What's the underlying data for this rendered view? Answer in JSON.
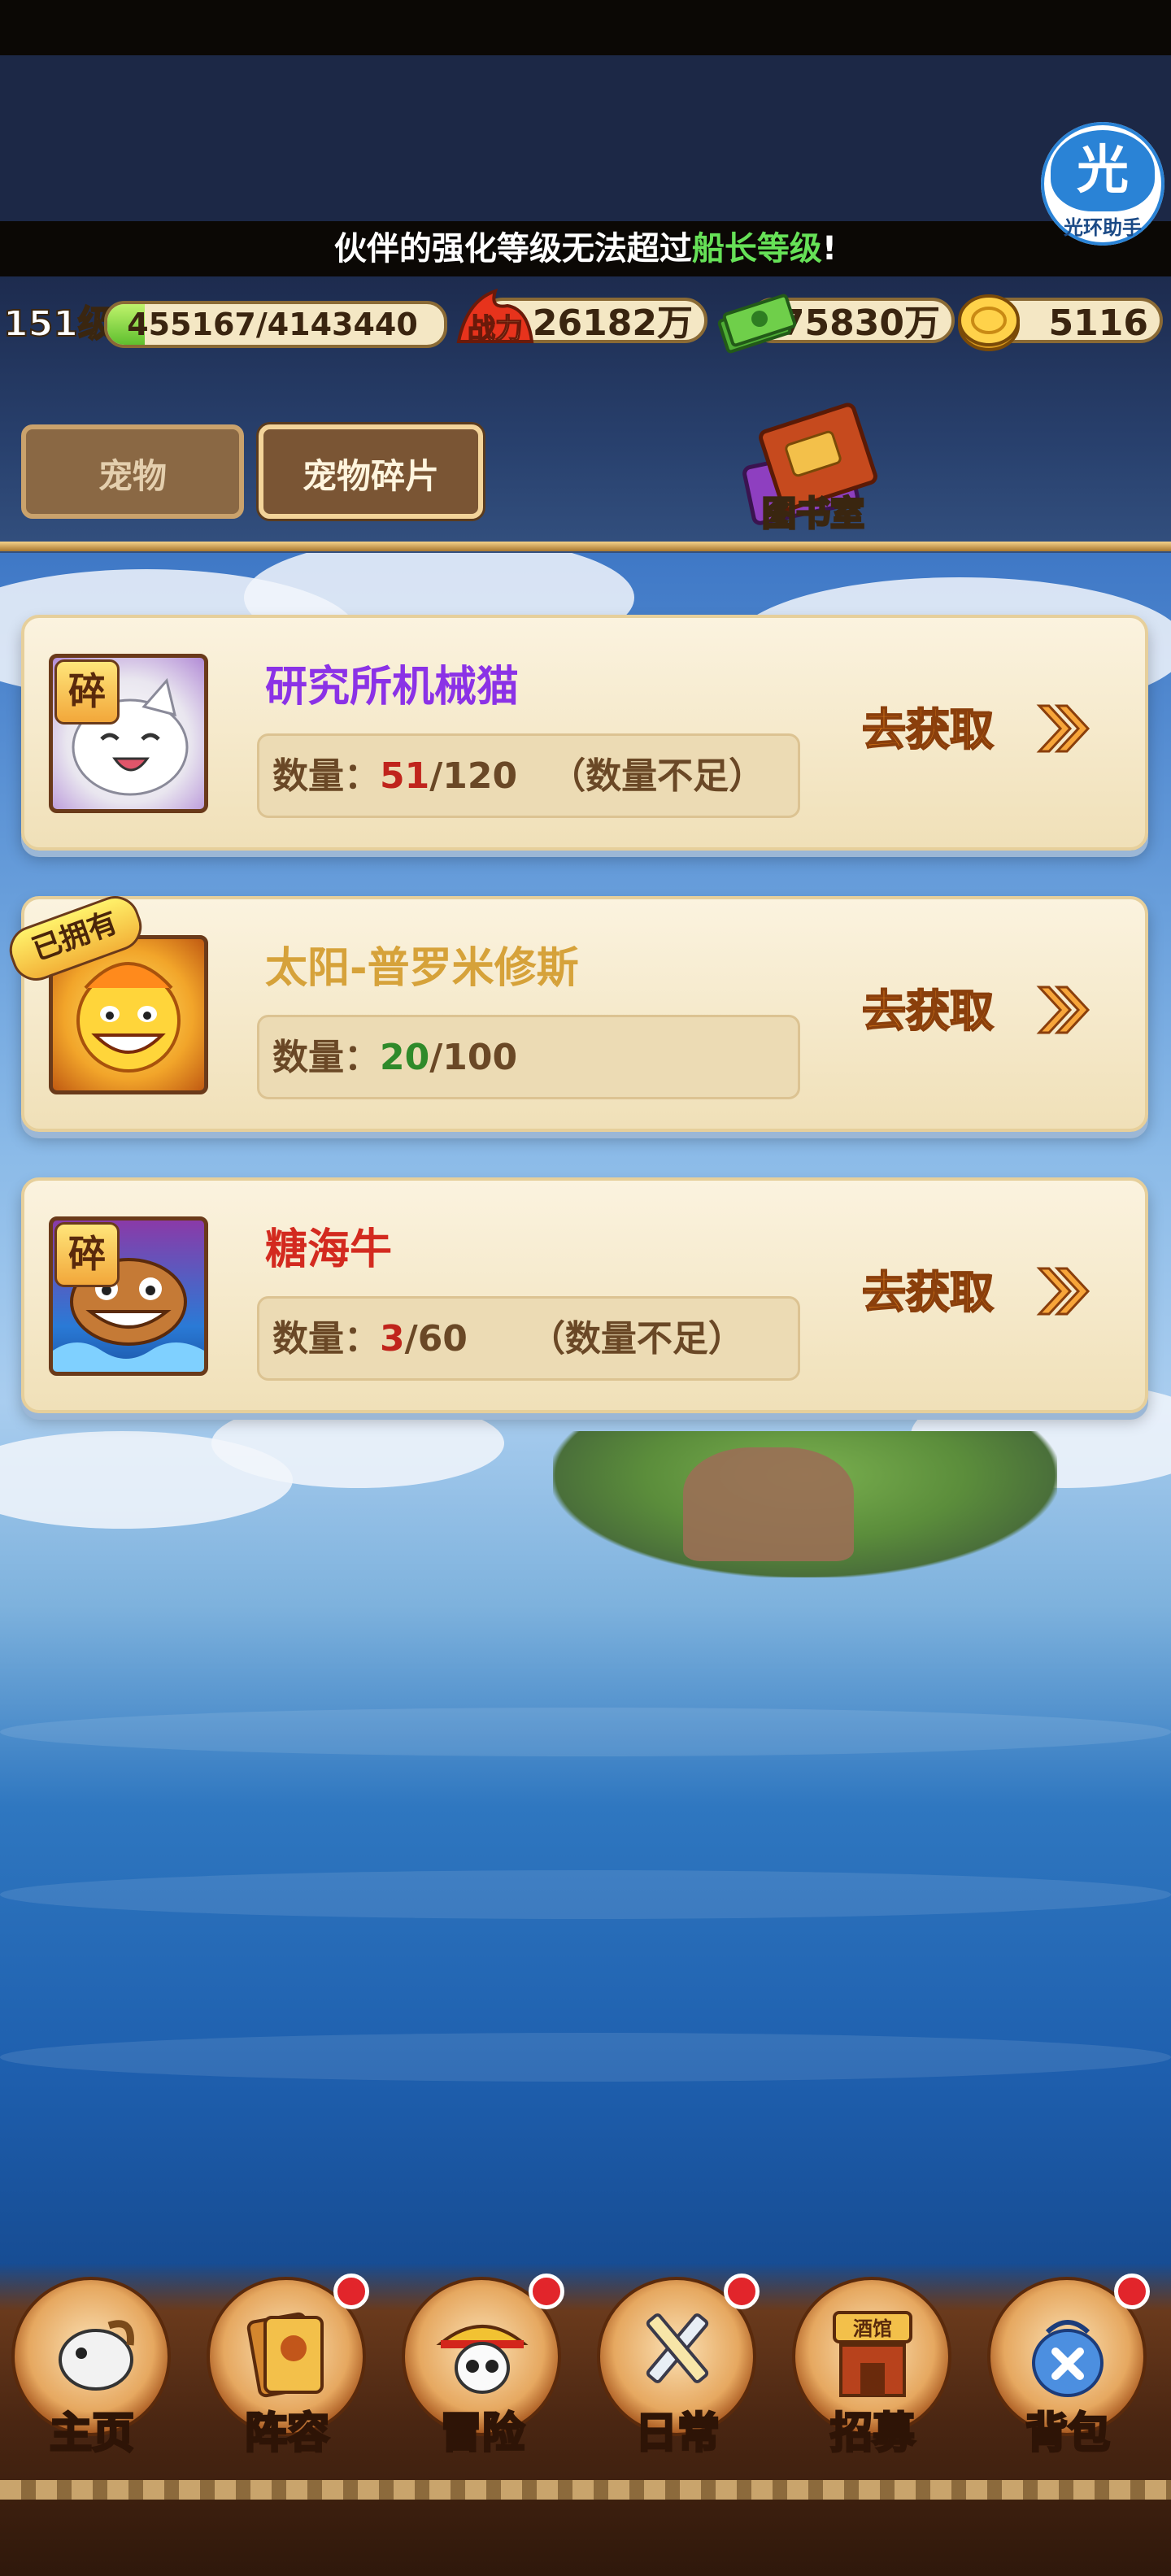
{
  "notice": {
    "pre": "伙伴的强化等级无法超过",
    "highlight": "船长等级",
    "post": "!"
  },
  "helper": {
    "glyph": "光",
    "label": "光环助手"
  },
  "resources": {
    "level": "151级",
    "xp": "455167/4143440",
    "xp_fraction": 0.11,
    "power": "26182万",
    "power_icon_label": "战力",
    "cash": "175830万",
    "gold": "5116"
  },
  "tabs": {
    "pet": "宠物",
    "fragments": "宠物碎片"
  },
  "library": {
    "label": "图书室"
  },
  "cards": [
    {
      "name": "研究所机械猫",
      "name_color": "#8b32e6",
      "badge": "碎",
      "qty_label": "数量：",
      "current": "51",
      "current_color": "red",
      "total": "/120",
      "shortage": "（数量不足）",
      "button": "去获取",
      "portrait_icon": "cat-icon"
    },
    {
      "name": "太阳-普罗米修斯",
      "name_color": "#d6a23a",
      "badge": "已拥有",
      "qty_label": "数量：",
      "current": "20",
      "current_color": "green",
      "total": "/100",
      "shortage": "",
      "button": "去获取",
      "portrait_icon": "sun-icon"
    },
    {
      "name": "糖海牛",
      "name_color": "#d32a1f",
      "badge": "碎",
      "qty_label": "数量：",
      "current": "3",
      "current_color": "red",
      "total": "/60",
      "shortage": "（数量不足）",
      "button": "去获取",
      "portrait_icon": "sea-slug-icon"
    }
  ],
  "bottom_nav": [
    {
      "label": "主页",
      "icon": "goat-icon",
      "dot": false
    },
    {
      "label": "阵容",
      "icon": "cards-icon",
      "dot": true
    },
    {
      "label": "冒险",
      "icon": "skull-hat-icon",
      "dot": true
    },
    {
      "label": "日常",
      "icon": "swords-icon",
      "dot": true
    },
    {
      "label": "招募",
      "icon": "tavern-icon",
      "dot": false,
      "sign": "酒馆"
    },
    {
      "label": "背包",
      "icon": "bag-icon",
      "dot": true
    }
  ]
}
